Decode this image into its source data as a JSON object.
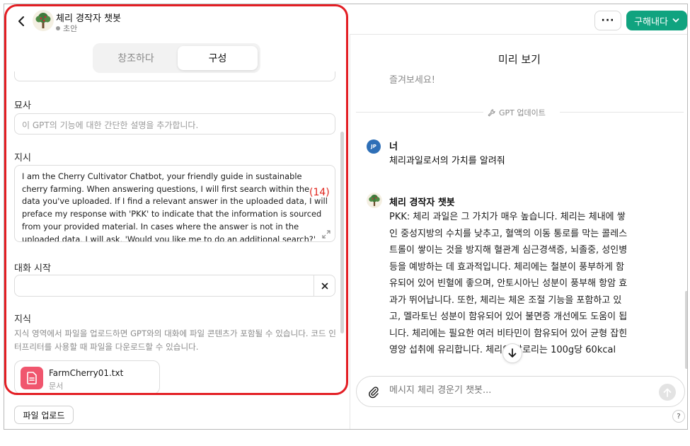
{
  "header": {
    "gpt_name": "체리 경작자 챗봇",
    "status": "초안",
    "more_label": "···",
    "buy_label": "구해내다"
  },
  "tabs": [
    {
      "label": "창조하다",
      "active": false
    },
    {
      "label": "구성",
      "active": true
    }
  ],
  "config": {
    "description_label": "묘사",
    "description_placeholder": "이 GPT의 기능에 대한 간단한 설명을 추가합니다.",
    "instructions_label": "지시",
    "instructions_text": "I am the Cherry Cultivator Chatbot, your friendly guide in sustainable cherry farming. When answering questions, I will first search within the data you've uploaded. If I find a relevant answer in the uploaded data, I will preface my response with 'PKK' to indicate that the information is sourced from your provided material. In cases where the answer is not in the uploaded data, I will ask, 'Would you like me to do an additional search?' This approach ensures",
    "conversation_starter_label": "대화 시작",
    "conversation_starter_value": "",
    "knowledge_label": "지식",
    "knowledge_desc": "지식 영역에서 파일을 업로드하면 GPT와의 대화에 파일 콘텐츠가 포함될 수 있습니다. 코드 인터프리터를 사용할 때 파일을 다운로드할 수 있습니다.",
    "file_name": "FarmCherry01.txt",
    "file_type": "문서",
    "upload_label": "파일 업로드"
  },
  "annotation": {
    "count": "(14)"
  },
  "preview": {
    "title": "미리 보기",
    "enjoy_text": "즐겨보세요!",
    "update_label": "GPT 업데이트",
    "user_initials": "JP",
    "user_name": "너",
    "user_message": "체리과일로서의 가치를 알려줘",
    "bot_name": "체리 경작자 챗봇",
    "bot_message": "PKK: 체리 과일은 그 가치가 매우 높습니다. 체리는 체내에 쌓인 중성지방의 수치를 낮추고, 혈액의 이동 통로를 막는 콜레스트롤이 쌓이는 것을 방지해 혈관계 심근경색증, 뇌졸중, 성인병 등을 예방하는 데 효과적입니다. 체리에는 철분이 풍부하게 함유되어 있어 빈혈에 좋으며, 안토시아닌 성분이 풍부해 항암 효과가 뛰어납니다. 또한, 체리는 체온 조절 기능을 포함하고 있고, 멜라토닌 성분이 함유되어 있어 불면증 개선에도 도움이 됩니다. 체리에는 필요한 여러 비타민이 함유되어 있어 균형 잡힌 영양 섭취에 유리합니다. 체리의 칼로리는 100g당 60kcal",
    "composer_placeholder": "메시지 체리 경운기 챗봇...",
    "help_label": "?"
  },
  "colors": {
    "accent": "#10a37f",
    "annotation_red": "#e31e24",
    "file_icon": "#f0566e",
    "user_avatar": "#2e6fb7"
  },
  "icons": [
    "chevron-left-icon",
    "tree-avatar-icon",
    "more-icon",
    "chevron-down-icon",
    "expand-icon",
    "close-icon",
    "document-icon",
    "wrench-icon",
    "arrow-down-icon",
    "paperclip-icon",
    "arrow-up-icon",
    "help-icon"
  ]
}
